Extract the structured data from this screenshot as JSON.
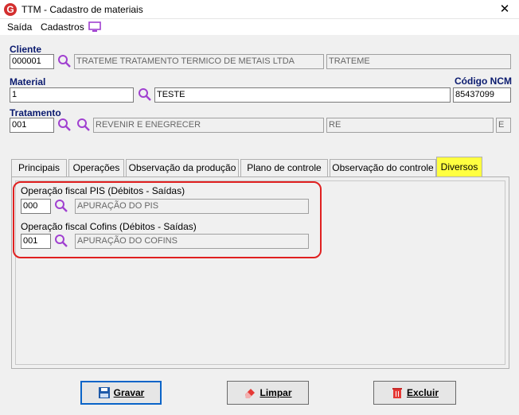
{
  "window": {
    "title": "TTM - Cadastro de materiais",
    "app_icon_letter": "G",
    "close_glyph": "✕"
  },
  "menu": {
    "items": [
      "Saída",
      "Cadastros"
    ]
  },
  "cliente": {
    "label": "Cliente",
    "code": "000001",
    "name": "TRATEME TRATAMENTO TERMICO DE METAIS LTDA",
    "short": "TRATEME"
  },
  "material": {
    "label": "Material",
    "code": "1",
    "name": "TESTE",
    "ncm_label": "Código NCM",
    "ncm": "85437099"
  },
  "tratamento": {
    "label": "Tratamento",
    "code": "001",
    "name": "REVENIR E ENEGRECER",
    "abbr": "RE",
    "extra": "E"
  },
  "tabs": [
    "Principais",
    "Operações",
    "Observação da produção",
    "Plano de controle",
    "Observação do controle",
    "Diversos"
  ],
  "diversos": {
    "pis_label": "Operação fiscal PIS (Débitos - Saídas)",
    "pis_code": "000",
    "pis_desc": "APURAÇÃO DO PIS",
    "cofins_label": "Operação fiscal Cofins (Débitos - Saídas)",
    "cofins_code": "001",
    "cofins_desc": "APURAÇÃO DO COFINS"
  },
  "buttons": {
    "save": "Gravar",
    "clear": "Limpar",
    "delete": "Excluir"
  },
  "colors": {
    "accent_label": "#0a1a6e",
    "active_tab": "#ffff40",
    "highlight": "#e02020",
    "search_icon": "#a040d0"
  }
}
